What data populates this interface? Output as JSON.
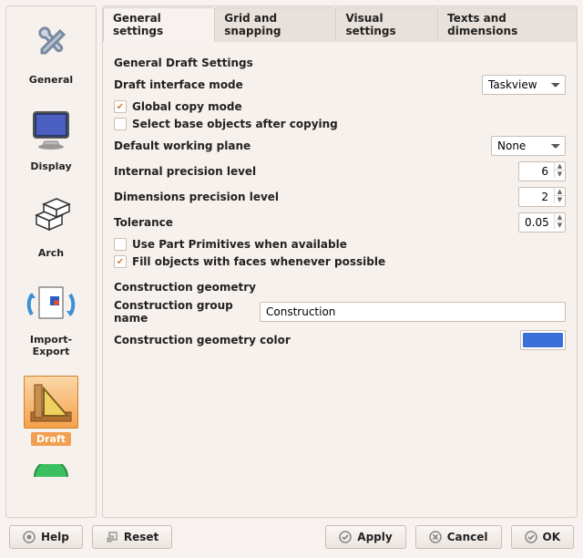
{
  "sidebar": {
    "items": [
      {
        "label": "General"
      },
      {
        "label": "Display"
      },
      {
        "label": "Arch"
      },
      {
        "label": "Import-Export"
      },
      {
        "label": "Draft"
      }
    ],
    "selected_index": 4
  },
  "tabs": {
    "items": [
      {
        "label": "General settings"
      },
      {
        "label": "Grid and snapping"
      },
      {
        "label": "Visual settings"
      },
      {
        "label": "Texts and dimensions"
      }
    ],
    "active_index": 0
  },
  "general": {
    "section_title": "General Draft Settings",
    "interface_mode": {
      "label": "Draft interface mode",
      "value": "Taskview"
    },
    "global_copy": {
      "label": "Global copy mode",
      "checked": true
    },
    "select_base": {
      "label": "Select base objects after copying",
      "checked": false
    },
    "working_plane": {
      "label": "Default working plane",
      "value": "None"
    },
    "internal_precision": {
      "label": "Internal precision level",
      "value": "6"
    },
    "dimensions_precision": {
      "label": "Dimensions precision level",
      "value": "2"
    },
    "tolerance": {
      "label": "Tolerance",
      "value": "0.05"
    },
    "use_primitives": {
      "label": "Use Part Primitives when available",
      "checked": false
    },
    "fill_faces": {
      "label": "Fill objects with faces whenever possible",
      "checked": true
    }
  },
  "construction": {
    "section_title": "Construction geometry",
    "group_name": {
      "label": "Construction group name",
      "value": "Construction"
    },
    "color": {
      "label": "Construction geometry color",
      "value": "#3b6fd8"
    }
  },
  "footer": {
    "help": "Help",
    "reset": "Reset",
    "apply": "Apply",
    "cancel": "Cancel",
    "ok": "OK"
  }
}
